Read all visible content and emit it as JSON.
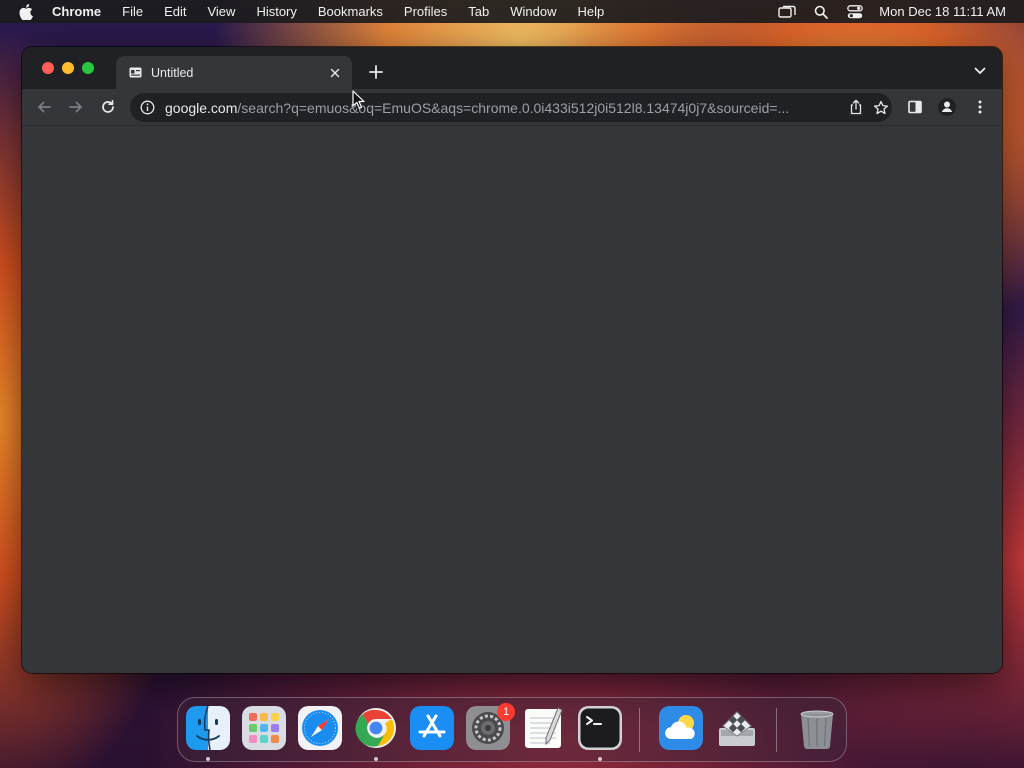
{
  "menubar": {
    "apple_icon": "apple-logo-icon",
    "app_name": "Chrome",
    "items": [
      "File",
      "Edit",
      "View",
      "History",
      "Bookmarks",
      "Profiles",
      "Tab",
      "Window",
      "Help"
    ],
    "status_icons": [
      "screen-mirroring-icon",
      "spotlight-search-icon",
      "control-center-icon"
    ],
    "clock": "Mon Dec 18  11:11 AM"
  },
  "browser": {
    "tab": {
      "title": "Untitled",
      "favicon": "document-icon"
    },
    "omnibox": {
      "host": "google.com",
      "path": "/search?q=emuos&oq=EmuOS&aqs=chrome.0.0i433i512j0i512l8.13474j0j7&sourceid=..."
    },
    "colors": {
      "frame": "#202124",
      "toolbar": "#35363a",
      "content": "#35363a"
    }
  },
  "dock": {
    "apps": [
      "Finder",
      "Launchpad",
      "Safari",
      "Google Chrome",
      "App Store",
      "System Settings",
      "TextEdit",
      "Terminal",
      "Weather",
      "Boot Camp Assistant",
      "Trash"
    ],
    "settings_badge": "1"
  }
}
